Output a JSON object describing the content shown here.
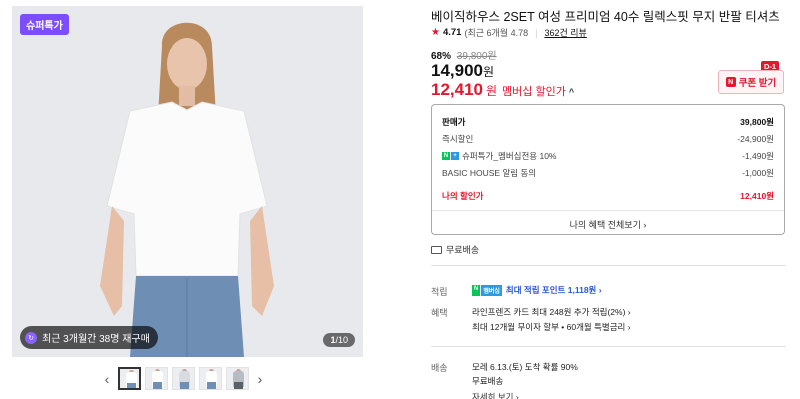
{
  "gallery": {
    "badge": "슈퍼특가",
    "recent_restock": "최근 3개월간 38명 재구매",
    "page_current": "1",
    "page_total": "/10",
    "prev_arrow": "‹",
    "next_arrow": "›",
    "thumb_count": 5
  },
  "product": {
    "title": "베이직하우스 2SET 여성 프리미엄 40수 릴렉스핏 무지 반팔 티셔츠",
    "rating": "4.71",
    "rating_detail": "(최근 6개월 4.78",
    "review_count": "362건 리뷰",
    "discount_pct": "68%",
    "original_price": "39,800원",
    "price": "14,900",
    "price_won": "원",
    "member_price": "12,410",
    "member_won": "원",
    "member_label": "멤버십 할인가",
    "coupon_label": "쿠폰 받기",
    "coupon_dday": "D-1"
  },
  "breakdown": {
    "header_label": "판매가",
    "header_value": "39,800원",
    "rows": [
      {
        "label": "즉시할인",
        "value": "-24,900원"
      },
      {
        "label": "슈퍼특가_멤버십전용 10%",
        "value": "-1,490원",
        "npay": true
      },
      {
        "label": "BASIC HOUSE 알림 동의",
        "value": "-1,000원"
      }
    ],
    "my_label": "나의 할인가",
    "my_value": "12,410원",
    "footer": "나의 혜택 전체보기 ›"
  },
  "shipping_free": "무료배송",
  "benefits": {
    "points_label": "적립",
    "points_text": "최대 적립 포인트",
    "points_value": "1,118원",
    "points_chevron": "›",
    "benefit_label": "혜택",
    "benefit_line1": "라인프렌즈 카드 최대 248원 추가 적립(2%) ›",
    "benefit_line2": "최대 12개월 무이자 할부 • 60개월 특별금리 ›",
    "delivery_label": "배송",
    "delivery_line1": "모레 6.13.(토) 도착 확률 90%",
    "delivery_line2": "무료배송",
    "delivery_link": "자세히 보기 ›"
  },
  "colors": {
    "accent_red": "#e5162e",
    "super_purple": "#7b4dff",
    "naver_green": "#03c75a"
  }
}
